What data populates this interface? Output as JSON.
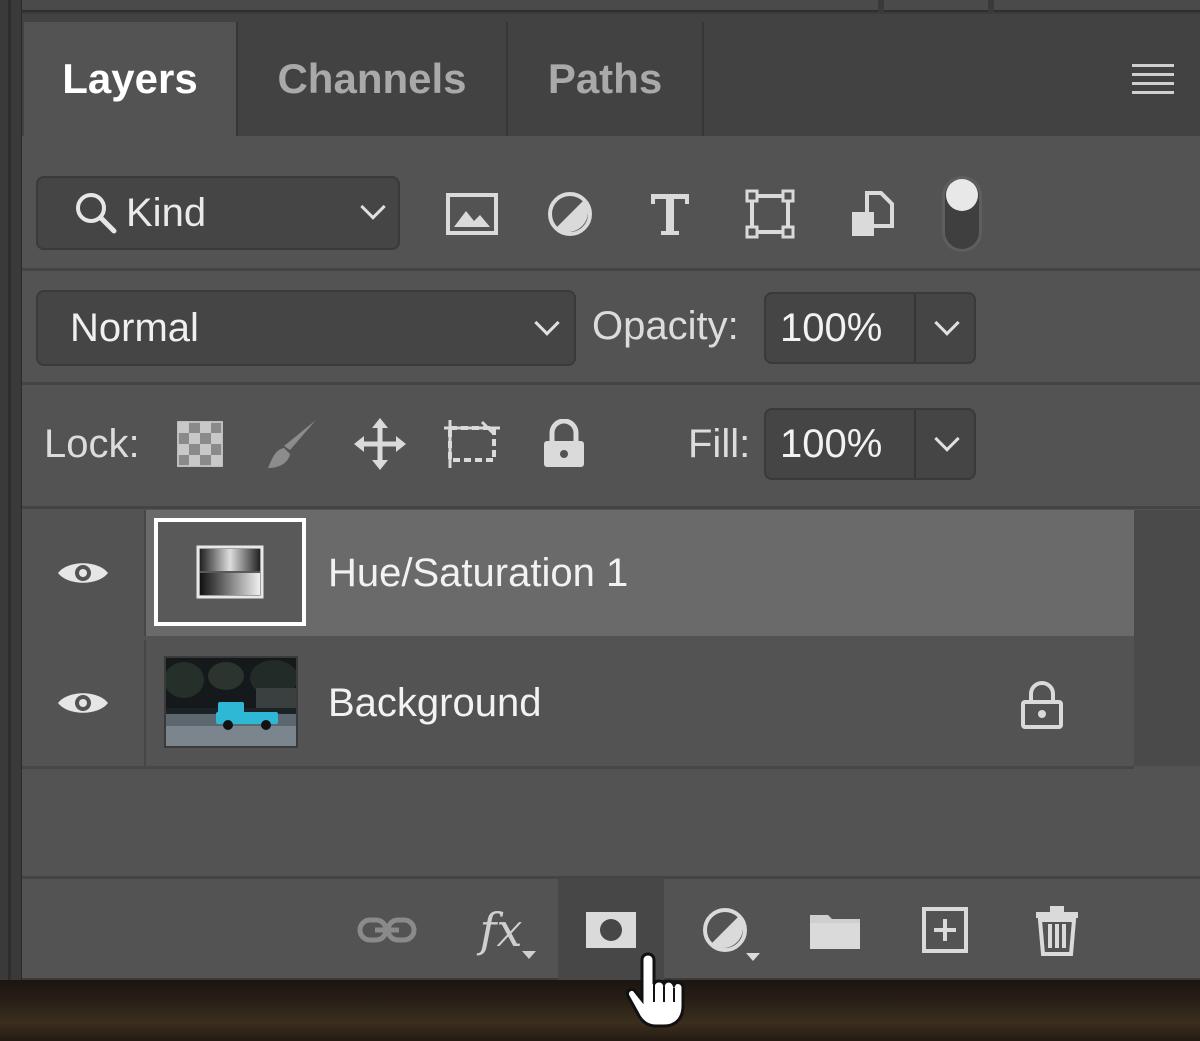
{
  "tabs": [
    {
      "label": "Layers",
      "active": true
    },
    {
      "label": "Channels",
      "active": false
    },
    {
      "label": "Paths",
      "active": false
    }
  ],
  "filter": {
    "kind_label": "Kind",
    "icons": [
      "image-filter-icon",
      "adjustment-filter-icon",
      "type-filter-icon",
      "shape-filter-icon",
      "smart-object-filter-icon"
    ],
    "toggle_on": true
  },
  "blend": {
    "mode": "Normal",
    "opacity_label": "Opacity:",
    "opacity_value": "100%"
  },
  "lock": {
    "label": "Lock:",
    "icons": [
      "lock-transparent-icon",
      "lock-image-icon",
      "lock-position-icon",
      "lock-artboard-icon",
      "lock-all-icon"
    ],
    "fill_label": "Fill:",
    "fill_value": "100%"
  },
  "layers": [
    {
      "name": "Hue/Saturation 1",
      "type": "adjustment",
      "visible": true,
      "selected": true,
      "locked": false
    },
    {
      "name": "Background",
      "type": "image",
      "visible": true,
      "selected": false,
      "locked": true
    }
  ],
  "bottom_toolbar": {
    "icons": [
      "link-layers-icon",
      "fx-icon",
      "add-mask-icon",
      "new-adjustment-icon",
      "new-group-icon",
      "new-layer-icon",
      "delete-layer-icon"
    ],
    "fx_label": "fx",
    "hovered": "add-mask-icon"
  },
  "colors": {
    "panel_bg": "#535353",
    "tab_bar_bg": "#424242",
    "selected_row": "#6a6a6a",
    "text": "#f2f2f2",
    "truck_cyan": "#2fb7d6"
  }
}
